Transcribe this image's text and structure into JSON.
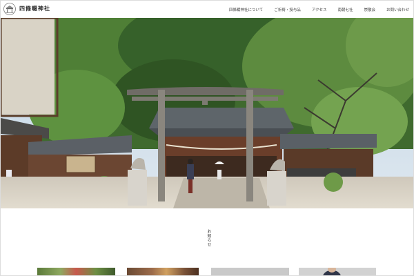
{
  "header": {
    "site_title": "四條畷神社",
    "logo_icon": "shrine-emblem-icon",
    "nav": [
      {
        "label": "四條畷神社について"
      },
      {
        "label": "ご祈祷・授与品"
      },
      {
        "label": "アクセス"
      },
      {
        "label": "南朝七社"
      },
      {
        "label": "崇敬会"
      },
      {
        "label": "お問い合わせ"
      }
    ]
  },
  "hero": {
    "image_icon": "shrine-torii-gate-photo"
  },
  "news": {
    "heading": "お知らせ"
  },
  "colors": {
    "header_bg": "#ffffff",
    "text": "#333333",
    "torii": "#7d7a72"
  }
}
